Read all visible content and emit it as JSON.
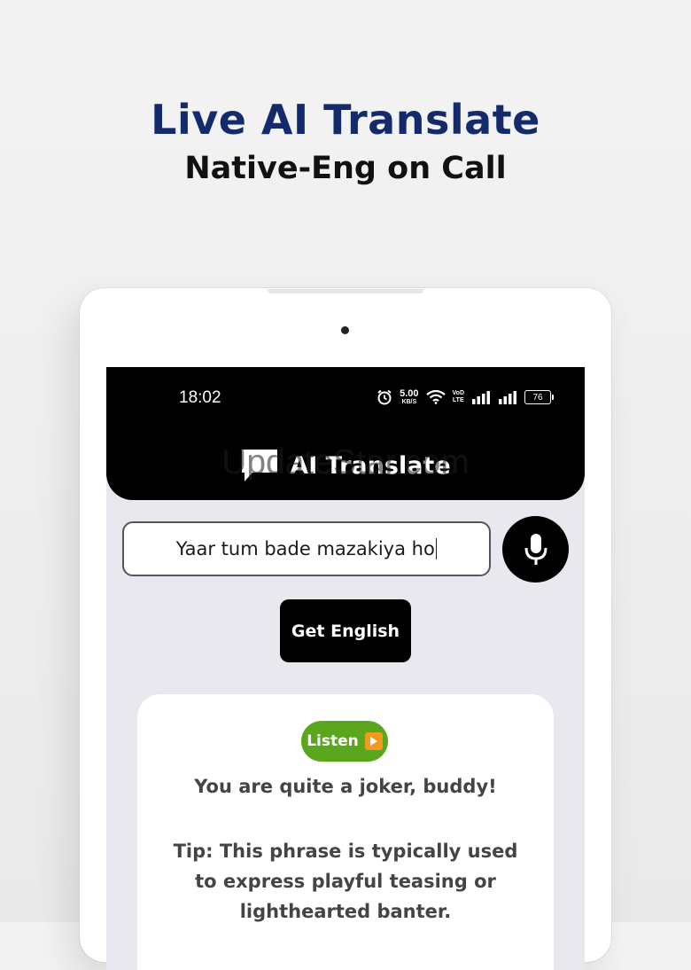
{
  "promo": {
    "headline": "Live AI Translate",
    "subheadline": "Native-Eng on Call"
  },
  "status_bar": {
    "time": "18:02",
    "net_speed_value": "5.00",
    "net_speed_unit": "KB/S",
    "volte_top": "VoD",
    "volte_bottom": "LTE",
    "battery": "76",
    "icons": [
      "alarm-icon",
      "wifi-icon",
      "signal-icon",
      "signal-icon",
      "battery-icon"
    ]
  },
  "app": {
    "title": "AI Translate",
    "watermark": "UpdateStar.com"
  },
  "input": {
    "value": "Yaar tum bade mazakiya ho"
  },
  "actions": {
    "get_english_label": "Get English",
    "listen_label": "Listen"
  },
  "result": {
    "translation": "You are quite a joker, buddy!",
    "tip": "Tip: This phrase is typically used to express playful teasing or lighthearted banter."
  },
  "colors": {
    "headline": "#132a6b",
    "header_bg": "#000000",
    "listen_green": "#5aa61c",
    "play_orange": "#f39a1e"
  }
}
